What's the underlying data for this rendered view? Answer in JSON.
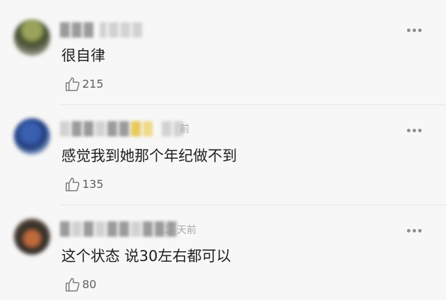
{
  "comments": [
    {
      "text": "很自律",
      "time": "",
      "likes": "215",
      "like_icon": "thumbs-up-icon",
      "more_icon": "more-dots-icon"
    },
    {
      "text": "感觉我到她那个年纪做不到",
      "time": "前",
      "likes": "135",
      "like_icon": "thumbs-up-icon",
      "more_icon": "more-dots-icon"
    },
    {
      "text": "这个状态 说30左右都可以",
      "time": "21天前",
      "likes": "80",
      "like_icon": "thumbs-up-icon",
      "more_icon": "more-dots-icon"
    }
  ],
  "colors": {
    "background": "#f7f7f7",
    "text": "#1e1e1e",
    "muted": "#a9a9a9",
    "icon": "#7a7a7a"
  }
}
